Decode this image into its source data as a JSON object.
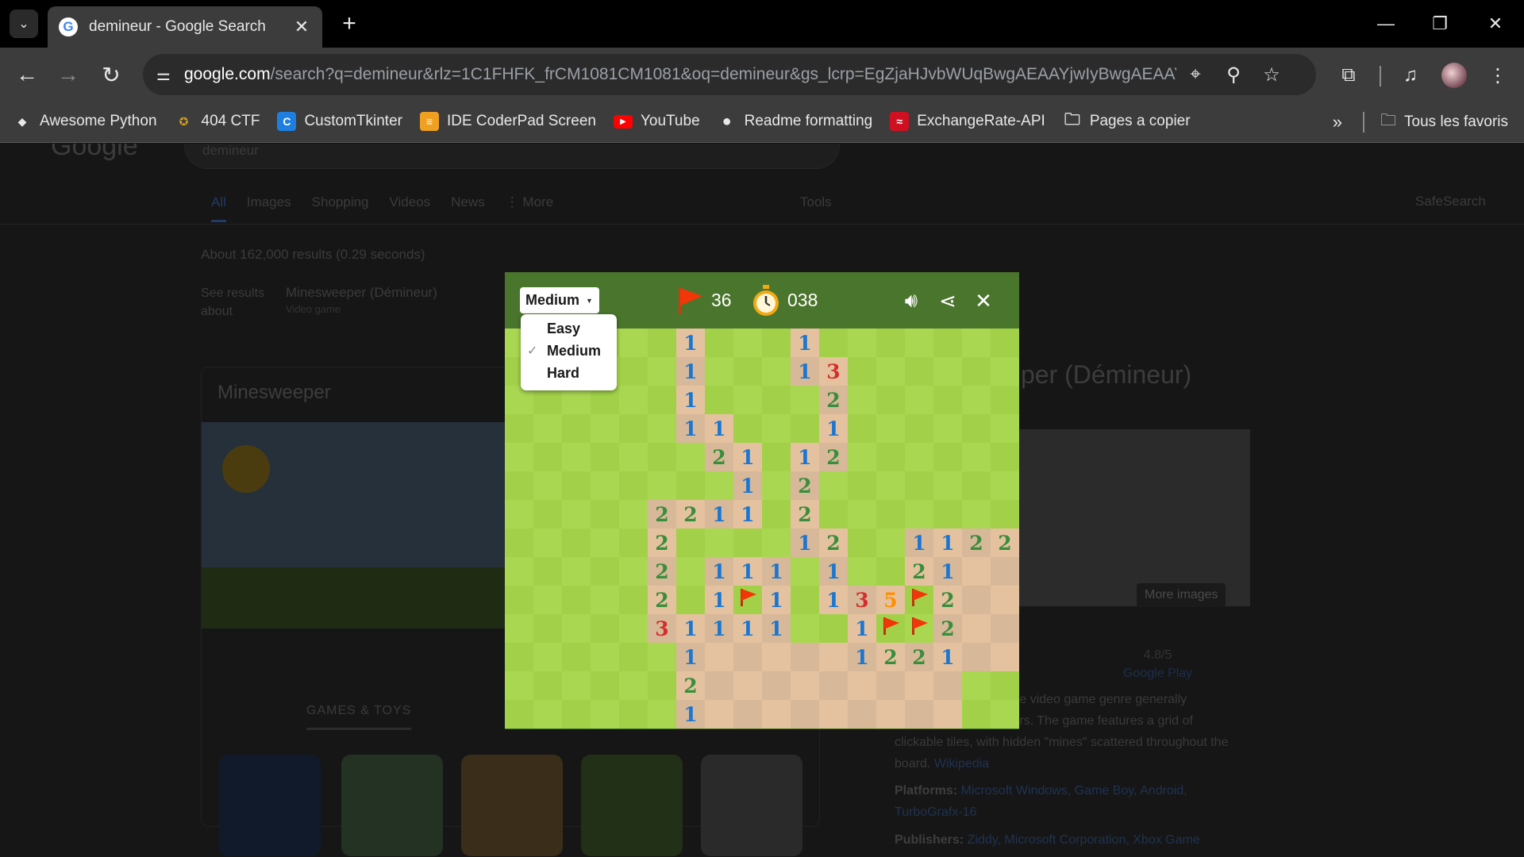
{
  "browser": {
    "tab_title": "demineur - Google Search",
    "url_host": "google.com",
    "url_rest": "/search?q=demineur&rlz=1C1FHFK_frCM1081CM1081&oq=demineur&gs_lcrp=EgZjaHJvbWUqBwgAEAAYjwIyBwgAEAAYj...",
    "bookmarks": [
      {
        "label": "Awesome Python",
        "icon": "python-icon",
        "color": "#e8e8e8"
      },
      {
        "label": "404 CTF",
        "icon": "ctf-icon",
        "color": "#d8a020"
      },
      {
        "label": "CustomTkinter",
        "icon": "tkinter-icon",
        "color": "#1f7fe0"
      },
      {
        "label": "IDE CoderPad Screen",
        "icon": "coderpad-icon",
        "color": "#f0a020"
      },
      {
        "label": "YouTube",
        "icon": "youtube-icon",
        "color": "#ff0000"
      },
      {
        "label": "Readme formatting",
        "icon": "github-icon",
        "color": "#e8e8e8"
      },
      {
        "label": "ExchangeRate-API",
        "icon": "exchangerate-icon",
        "color": "#d01020"
      },
      {
        "label": "Pages a copier",
        "icon": "folder-icon",
        "color": "#e8e8e8"
      }
    ],
    "all_bookmarks": "Tous les favoris"
  },
  "results_page": {
    "logo": "Google",
    "query": "demineur",
    "tabs": [
      "All",
      "Images",
      "Shopping",
      "Videos",
      "News",
      "⋮ More"
    ],
    "tools": "Tools",
    "safesearch": "SafeSearch",
    "stats": "About 162,000 results (0.29 seconds)",
    "see_results": "See results",
    "about": "about",
    "about_title": "Minesweeper (Démineur)",
    "about_sub": "Video game",
    "card_title": "Minesweeper",
    "games_label": "GAMES & TOYS",
    "right_title": "per (Démineur)",
    "more_images": "More images",
    "rating": "4.8/5",
    "rating_source": "Google Play",
    "desc_1": "ic puzzle video game genre generally",
    "desc_2": "omputers. The game features a grid of",
    "desc_3": "clickable tiles, with hidden \"mines\" scattered throughout the",
    "desc_4": "board.",
    "desc_link": "Wikipedia",
    "platforms_label": "Platforms:",
    "platforms_value": "Microsoft Windows, Game Boy, Android,",
    "platforms_value2": "TurboGrafx-16",
    "publishers_label": "Publishers:",
    "publishers_value": "Ziddy, Microsoft Corporation, Xbox Game"
  },
  "game": {
    "difficulty": "Medium",
    "flags_left": "36",
    "timer": "038",
    "menu_options": [
      "Easy",
      "Medium",
      "Hard"
    ],
    "selected_option": "Medium",
    "board_rows": [
      "......1...1.......",
      "......1...13......",
      "......1....2......",
      "......11...1......",
      ".......21.12......",
      "........1.2.......",
      ".....2211.2.......",
      ".....2....12..1122",
      ".....2.111.1..21__",
      ".....2.1F1.135F2__",
      ".....31111..1FF2__",
      "......1_____1221__",
      "......2_________..",
      "......1_________.."
    ],
    "legend": {
      ".": "unrevealed",
      "_": "revealed-empty",
      "F": "flag",
      "1-8": "revealed-number"
    },
    "colors": {
      "header": "#4a752c",
      "grass_light": "#aad751",
      "grass_dark": "#a2d149",
      "dirt_light": "#e5c29f",
      "dirt_dark": "#d7b899",
      "n1": "#1976d2",
      "n2": "#388e3c",
      "n3": "#d32f2f",
      "n5": "#ff8f00",
      "flag": "#f23607"
    }
  }
}
